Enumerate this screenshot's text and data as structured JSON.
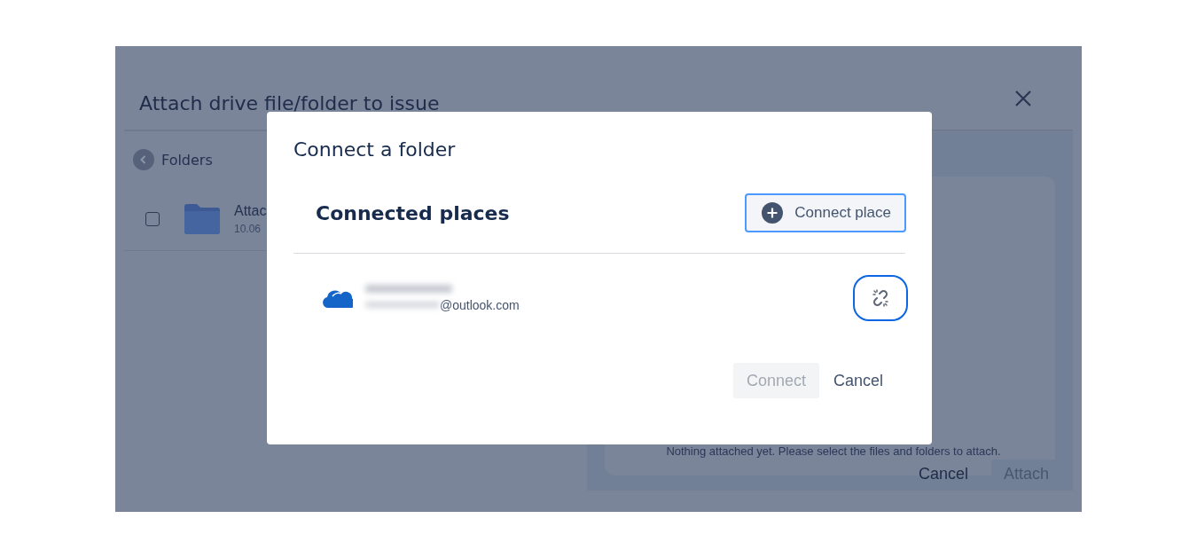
{
  "background_dialog": {
    "title": "Attach drive file/folder to issue",
    "back_label": "Folders",
    "items": [
      {
        "name": "Attac",
        "meta": "10.06",
        "checked": false
      }
    ],
    "empty_message": "Nothing attached yet. Please select the files and folders to attach.",
    "buttons": [
      {
        "label": "Cancel",
        "kind": "subtle",
        "disabled": false
      },
      {
        "label": "Attach",
        "kind": "primary",
        "disabled": true
      }
    ]
  },
  "modal": {
    "title": "Connect a folder",
    "section_title": "Connected places",
    "connect_place_button": "Connect place",
    "accounts": [
      {
        "name_redacted": true,
        "email_redacted": true,
        "email": "@outlook.com"
      }
    ],
    "buttons": [
      {
        "label": "Connect",
        "kind": "primary",
        "disabled": true
      },
      {
        "label": "Cancel",
        "kind": "subtle",
        "disabled": false
      }
    ]
  }
}
